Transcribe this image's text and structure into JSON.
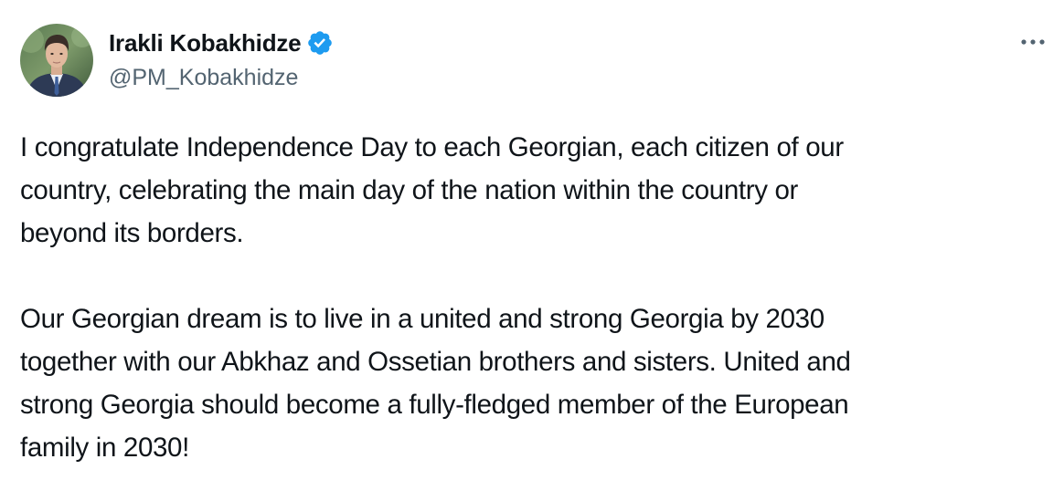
{
  "author": {
    "display_name": "Irakli Kobakhidze",
    "handle": "@PM_Kobakhidze",
    "verified": true,
    "avatar_icon": "profile-photo",
    "badge_icon": "verified-badge-icon"
  },
  "menu": {
    "icon": "more-options-icon"
  },
  "tweet": {
    "paragraphs": [
      {
        "lines": [
          "I congratulate Independence Day to each Georgian,  each citizen of our",
          "country, celebrating the main day of the nation within the country or",
          "beyond its borders."
        ]
      },
      {
        "lines": [
          "Our Georgian dream is to live in a united and strong Georgia by 2030",
          "together with our Abkhaz and Ossetian brothers and sisters.  United and",
          "strong Georgia should become a fully-fledged member of the European",
          "family in 2030!"
        ]
      }
    ]
  },
  "colors": {
    "text": "#0f1419",
    "secondary": "#536471",
    "verified_blue": "#1d9bf0",
    "background": "#ffffff"
  }
}
